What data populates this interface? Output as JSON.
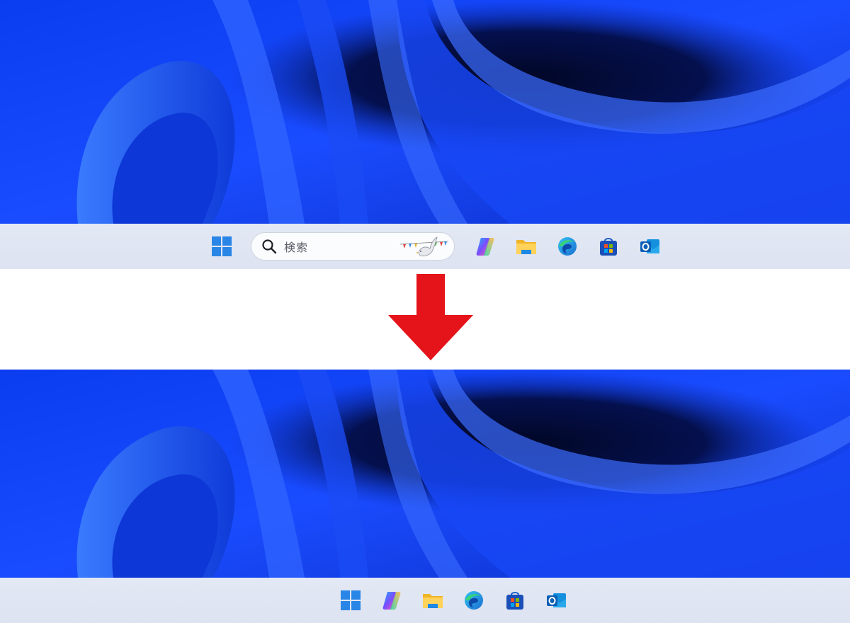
{
  "before": {
    "taskbar": {
      "search": {
        "placeholder": "検索"
      },
      "icons": [
        "windows-start-icon",
        "copilot-icon",
        "file-explorer-icon",
        "edge-icon",
        "microsoft-store-icon",
        "outlook-icon"
      ]
    }
  },
  "after": {
    "taskbar": {
      "icons": [
        "windows-start-icon",
        "copilot-icon",
        "file-explorer-icon",
        "edge-icon",
        "microsoft-store-icon",
        "outlook-icon"
      ]
    }
  },
  "colors": {
    "arrow": "#e5141b",
    "taskbar": "#e0e6f3",
    "wallpaper_primary": "#1a4cff",
    "wallpaper_dark": "#030a3a"
  }
}
